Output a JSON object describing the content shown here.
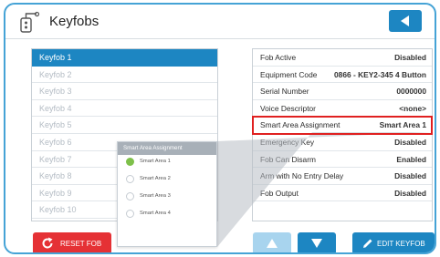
{
  "header": {
    "title": "Keyfobs",
    "back_icon": "back-arrow-icon"
  },
  "keyfobs": [
    "Keyfob 1",
    "Keyfob 2",
    "Keyfob 3",
    "Keyfob 4",
    "Keyfob 5",
    "Keyfob 6",
    "Keyfob 7",
    "Keyfob 8",
    "Keyfob 9",
    "Keyfob 10"
  ],
  "selected_keyfob": "Keyfob 1",
  "properties": [
    {
      "name": "Fob Active",
      "value": "Disabled"
    },
    {
      "name": "Equipment Code",
      "value": "0866 - KEY2-345 4 Button"
    },
    {
      "name": "Serial Number",
      "value": "0000000"
    },
    {
      "name": "Voice Descriptor",
      "value": "<none>"
    },
    {
      "name": "Smart Area Assignment",
      "value": "Smart Area 1"
    },
    {
      "name": "Emergency Key",
      "value": "Disabled"
    },
    {
      "name": "Fob Can Disarm",
      "value": "Enabled"
    },
    {
      "name": "Arm with No Entry Delay",
      "value": "Disabled"
    },
    {
      "name": "Fob Output",
      "value": "Disabled"
    }
  ],
  "popup": {
    "title": "Smart Area Assignment",
    "options": [
      "Smart Area 1",
      "Smart Area 2",
      "Smart Area 3",
      "Smart Area 4"
    ],
    "selected": "Smart Area 1"
  },
  "buttons": {
    "reset": "RESET FOB",
    "edit": "EDIT KEYFOB"
  },
  "colors": {
    "accent": "#1d86c2",
    "danger": "#e53135",
    "highlight": "#e02020",
    "radio_on": "#7ec04a"
  }
}
